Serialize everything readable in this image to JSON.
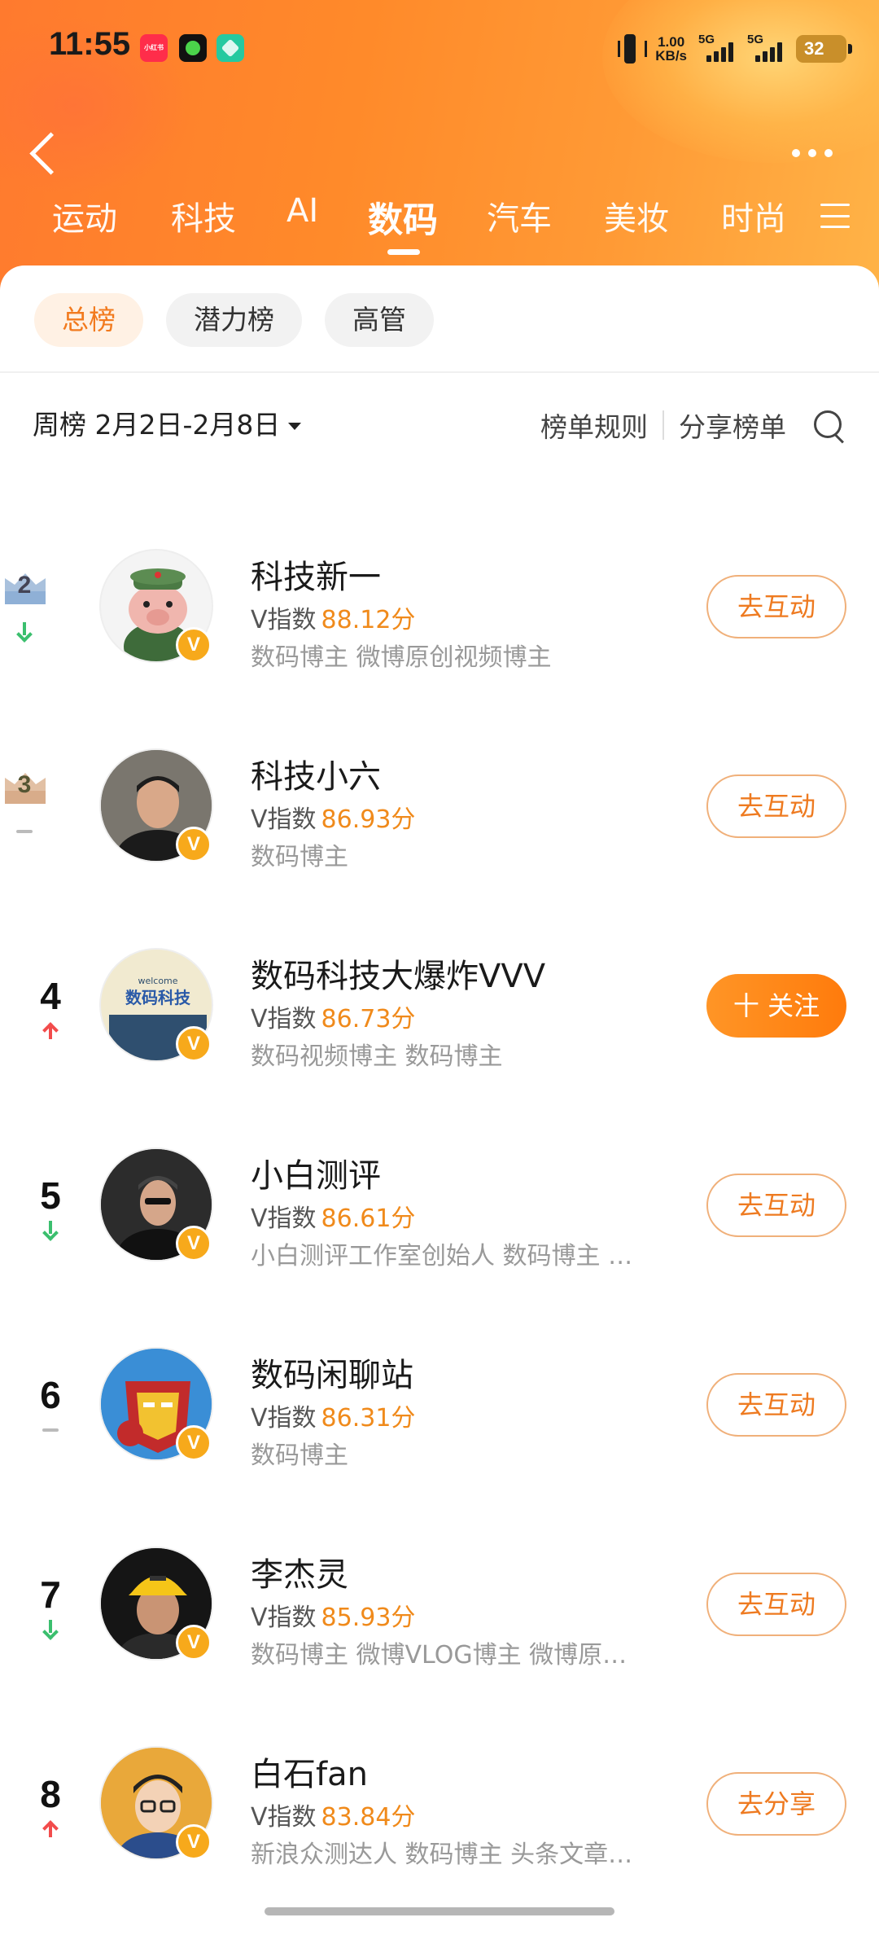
{
  "status_bar": {
    "time": "11:55",
    "app_chip": "小红书",
    "net_speed_value": "1.00",
    "net_speed_unit": "KB/s",
    "sim1": "5G",
    "sim2": "5G",
    "battery": "32"
  },
  "tabs": [
    {
      "label": "运动"
    },
    {
      "label": "科技"
    },
    {
      "label": "AI"
    },
    {
      "label": "数码",
      "active": true
    },
    {
      "label": "汽车"
    },
    {
      "label": "美妆"
    },
    {
      "label": "时尚"
    }
  ],
  "sub_tabs": [
    {
      "label": "总榜",
      "active": true
    },
    {
      "label": "潜力榜"
    },
    {
      "label": "高管"
    }
  ],
  "toolbar": {
    "period": "周榜 2月2日-2月8日",
    "rules": "榜单规则",
    "share": "分享榜单"
  },
  "colors": {
    "accent": "#ff8a2a",
    "score": "#f08a1b",
    "trend_up": "#f24c4c",
    "trend_down": "#3bbf6e"
  },
  "rankings": [
    {
      "rank": "2",
      "rank_style": "silver-crown",
      "trend": "down",
      "name": "科技新一",
      "score_label": "V指数",
      "score": "88.12分",
      "tags": "数码博主 微博原创视频博主",
      "action": "去互动"
    },
    {
      "rank": "3",
      "rank_style": "bronze-crown",
      "trend": "same",
      "name": "科技小六",
      "score_label": "V指数",
      "score": "86.93分",
      "tags": "数码博主",
      "action": "去互动"
    },
    {
      "rank": "4",
      "trend": "up",
      "name": "数码科技大爆炸VVV",
      "score_label": "V指数",
      "score": "86.73分",
      "tags": "数码视频博主 数码博主",
      "action": "十 关注",
      "primary": true
    },
    {
      "rank": "5",
      "trend": "down",
      "name": "小白测评",
      "score_label": "V指数",
      "score": "86.61分",
      "tags": "小白测评工作室创始人 数码博主 …",
      "action": "去互动"
    },
    {
      "rank": "6",
      "trend": "same",
      "name": "数码闲聊站",
      "score_label": "V指数",
      "score": "86.31分",
      "tags": "数码博主",
      "action": "去互动"
    },
    {
      "rank": "7",
      "trend": "down",
      "name": "李杰灵",
      "score_label": "V指数",
      "score": "85.93分",
      "tags": "数码博主 微博VLOG博主 微博原…",
      "action": "去互动"
    },
    {
      "rank": "8",
      "trend": "up",
      "name": "白石fan",
      "score_label": "V指数",
      "score": "83.84分",
      "tags": "新浪众测达人 数码博主 头条文章…",
      "action": "去分享"
    }
  ],
  "avatar_texts": {
    "welcome": "welcome",
    "logo": "数码科技"
  }
}
